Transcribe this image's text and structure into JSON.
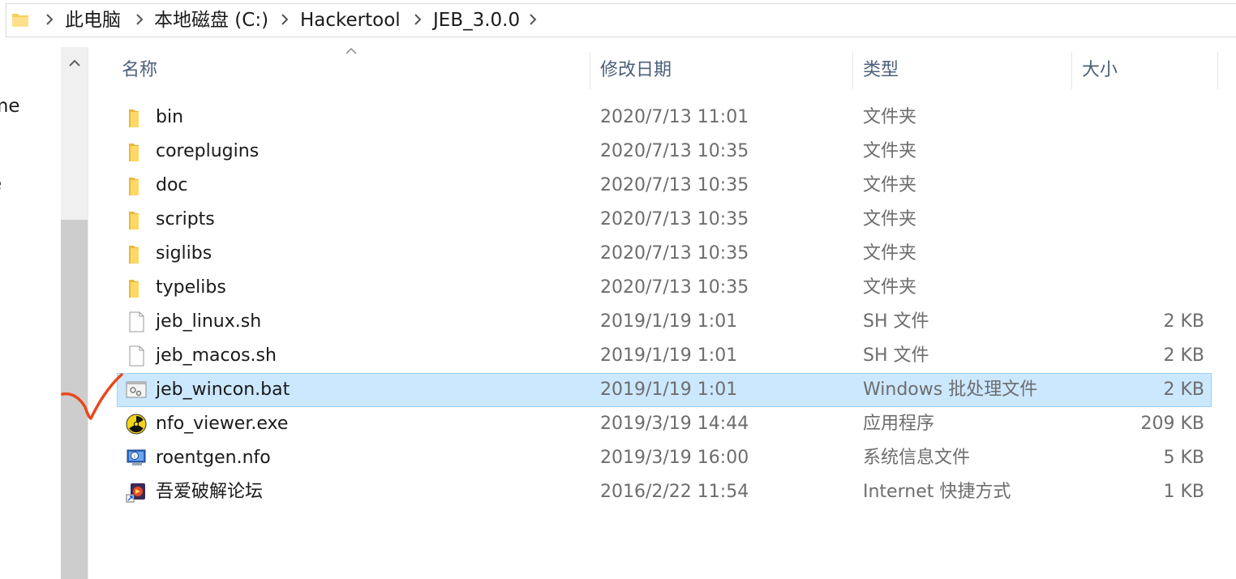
{
  "breadcrumb": {
    "items": [
      "此电脑",
      "本地磁盘 (C:)",
      "Hackertool",
      "JEB_3.0.0"
    ]
  },
  "nav": {
    "items": [
      "me",
      "e"
    ]
  },
  "columns": {
    "name": "名称",
    "date": "修改日期",
    "type": "类型",
    "size": "大小"
  },
  "files": [
    {
      "name": "bin",
      "date": "2020/7/13 11:01",
      "type": "文件夹",
      "size": "",
      "icon": "folder-icon"
    },
    {
      "name": "coreplugins",
      "date": "2020/7/13 10:35",
      "type": "文件夹",
      "size": "",
      "icon": "folder-icon"
    },
    {
      "name": "doc",
      "date": "2020/7/13 10:35",
      "type": "文件夹",
      "size": "",
      "icon": "folder-icon"
    },
    {
      "name": "scripts",
      "date": "2020/7/13 10:35",
      "type": "文件夹",
      "size": "",
      "icon": "folder-icon"
    },
    {
      "name": "siglibs",
      "date": "2020/7/13 10:35",
      "type": "文件夹",
      "size": "",
      "icon": "folder-icon"
    },
    {
      "name": "typelibs",
      "date": "2020/7/13 10:35",
      "type": "文件夹",
      "size": "",
      "icon": "folder-icon"
    },
    {
      "name": "jeb_linux.sh",
      "date": "2019/1/19 1:01",
      "type": "SH 文件",
      "size": "2 KB",
      "icon": "file-icon"
    },
    {
      "name": "jeb_macos.sh",
      "date": "2019/1/19 1:01",
      "type": "SH 文件",
      "size": "2 KB",
      "icon": "file-icon"
    },
    {
      "name": "jeb_wincon.bat",
      "date": "2019/1/19 1:01",
      "type": "Windows 批处理文件",
      "size": "2 KB",
      "icon": "batch-file-icon",
      "selected": true
    },
    {
      "name": "nfo_viewer.exe",
      "date": "2019/3/19 14:44",
      "type": "应用程序",
      "size": "209 KB",
      "icon": "radiation-app-icon"
    },
    {
      "name": "roentgen.nfo",
      "date": "2019/3/19 16:00",
      "type": "系统信息文件",
      "size": "5 KB",
      "icon": "system-info-icon"
    },
    {
      "name": "吾爱破解论坛",
      "date": "2016/2/22 11:54",
      "type": "Internet 快捷方式",
      "size": "1 KB",
      "icon": "internet-shortcut-icon"
    }
  ],
  "colors": {
    "selection_bg": "#cce8ff",
    "selection_border": "#99d1ff",
    "header_text": "#4c607a",
    "annotation_mark": "#e8481c"
  }
}
